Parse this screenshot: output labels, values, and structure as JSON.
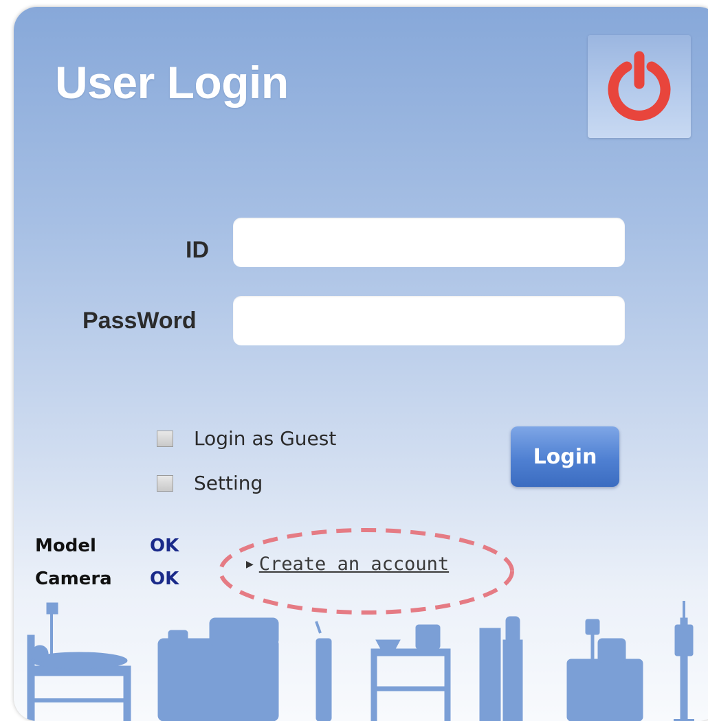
{
  "window": {
    "title": "User Login"
  },
  "power_button": {
    "icon": "power-icon",
    "color": "#e8453c"
  },
  "form": {
    "id_label": "ID",
    "id_value": "",
    "password_label": "PassWord",
    "password_value": ""
  },
  "options": {
    "guest_label": "Login as Guest",
    "guest_checked": false,
    "setting_label": "Setting",
    "setting_checked": false
  },
  "login_button": {
    "label": "Login"
  },
  "status": {
    "model_label": "Model",
    "model_value": "OK",
    "camera_label": "Camera",
    "camera_value": "OK"
  },
  "create_account": {
    "label": "Create an account",
    "highlight_color": "#e57b84"
  },
  "colors": {
    "accent_blue": "#4f80d2",
    "silhouette_blue": "#7b9fd6",
    "status_ok": "#1a2a8a"
  }
}
